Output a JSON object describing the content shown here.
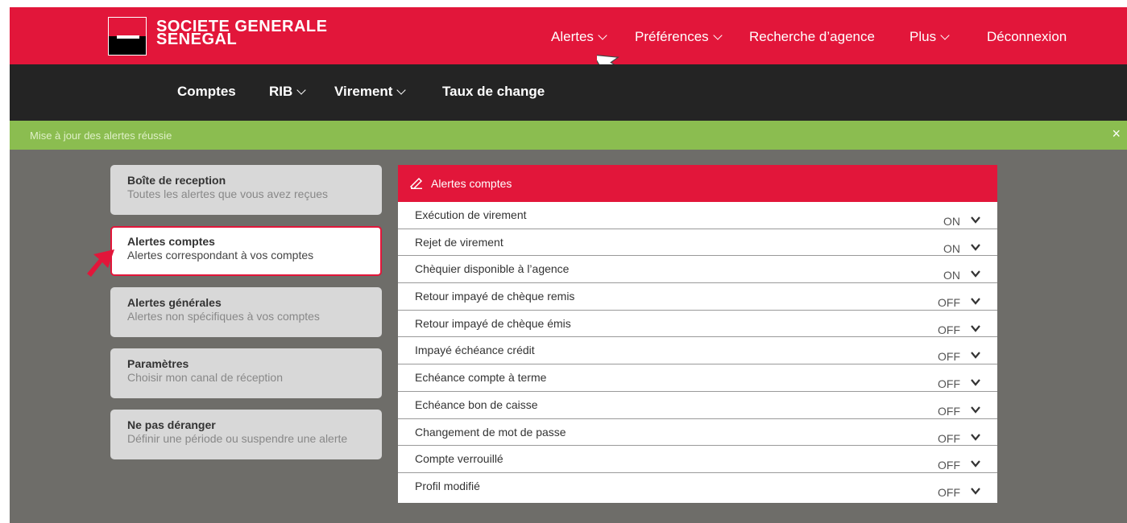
{
  "brand": {
    "line1": "SOCIETE GENERALE",
    "line2": "SENEGAL"
  },
  "topnav": {
    "alertes": "Alertes",
    "preferences": "Préférences",
    "recherche": "Recherche d’agence",
    "plus": "Plus",
    "deconnexion": "Déconnexion"
  },
  "subnav": {
    "comptes": "Comptes",
    "rib": "RIB",
    "virement": "Virement",
    "taux": "Taux de change"
  },
  "banner": {
    "message": "Mise à jour des alertes réussie",
    "close": "×"
  },
  "menu": [
    {
      "title": "Boîte de reception",
      "desc": "Toutes les alertes que vous avez reçues"
    },
    {
      "title": "Alertes comptes",
      "desc": "Alertes correspondant à vos comptes"
    },
    {
      "title": "Alertes générales",
      "desc": "Alertes non spécifiques à vos comptes"
    },
    {
      "title": "Paramètres",
      "desc": "Choisir mon canal de réception"
    },
    {
      "title": "Ne pas déranger",
      "desc": "Définir une période ou suspendre une alerte"
    }
  ],
  "panel": {
    "title": "Alertes comptes",
    "icon": "edit-pen-icon",
    "rows": [
      {
        "label": "Exécution de virement",
        "value": "ON"
      },
      {
        "label": "Rejet de virement",
        "value": "ON"
      },
      {
        "label": "Chèquier disponible à l’agence",
        "value": "ON"
      },
      {
        "label": "Retour impayé de chèque remis",
        "value": "OFF"
      },
      {
        "label": "Retour impayé de chèque émis",
        "value": "OFF"
      },
      {
        "label": "Impayé échéance crédit",
        "value": "OFF"
      },
      {
        "label": "Echéance compte à terme",
        "value": "OFF"
      },
      {
        "label": "Echéance bon de caisse",
        "value": "OFF"
      },
      {
        "label": "Changement de mot de passe",
        "value": "OFF"
      },
      {
        "label": "Compte verrouillé",
        "value": "OFF"
      },
      {
        "label": "Profil modifié",
        "value": "OFF"
      }
    ]
  },
  "colors": {
    "brand_red": "#e2163a",
    "dark_bar": "#242424",
    "success_green": "#8bbd50",
    "backdrop": "#6e6d69"
  }
}
